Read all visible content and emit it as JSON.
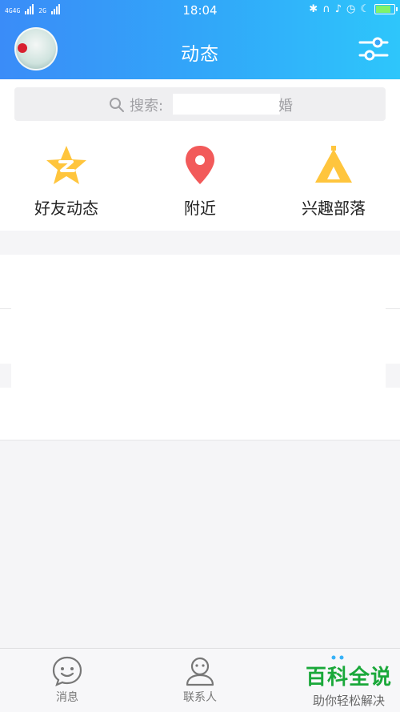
{
  "status_bar": {
    "network_left": "4G",
    "network_left2": "4G",
    "network_right": "2G",
    "time": "18:04"
  },
  "header": {
    "title": "动态",
    "avatar_icon": "user-avatar",
    "settings_icon": "sliders-icon",
    "accent_color": "#3a8cf8"
  },
  "search": {
    "label": "搜索:",
    "tail_text": "婚",
    "icon": "search-icon"
  },
  "quick_actions": [
    {
      "label": "好友动态",
      "icon": "qzone-star-icon",
      "color": "#ffc53d"
    },
    {
      "label": "附近",
      "icon": "location-pin-icon",
      "color": "#f25a5a"
    },
    {
      "label": "兴趣部落",
      "icon": "tent-icon",
      "color": "#ffc53d"
    }
  ],
  "tabbar": {
    "tabs": [
      {
        "label": "消息",
        "icon": "message-smile-icon"
      },
      {
        "label": "联系人",
        "icon": "contacts-person-icon"
      }
    ]
  },
  "watermark": {
    "line1": "百科全说",
    "line2": "助你轻松解决"
  }
}
